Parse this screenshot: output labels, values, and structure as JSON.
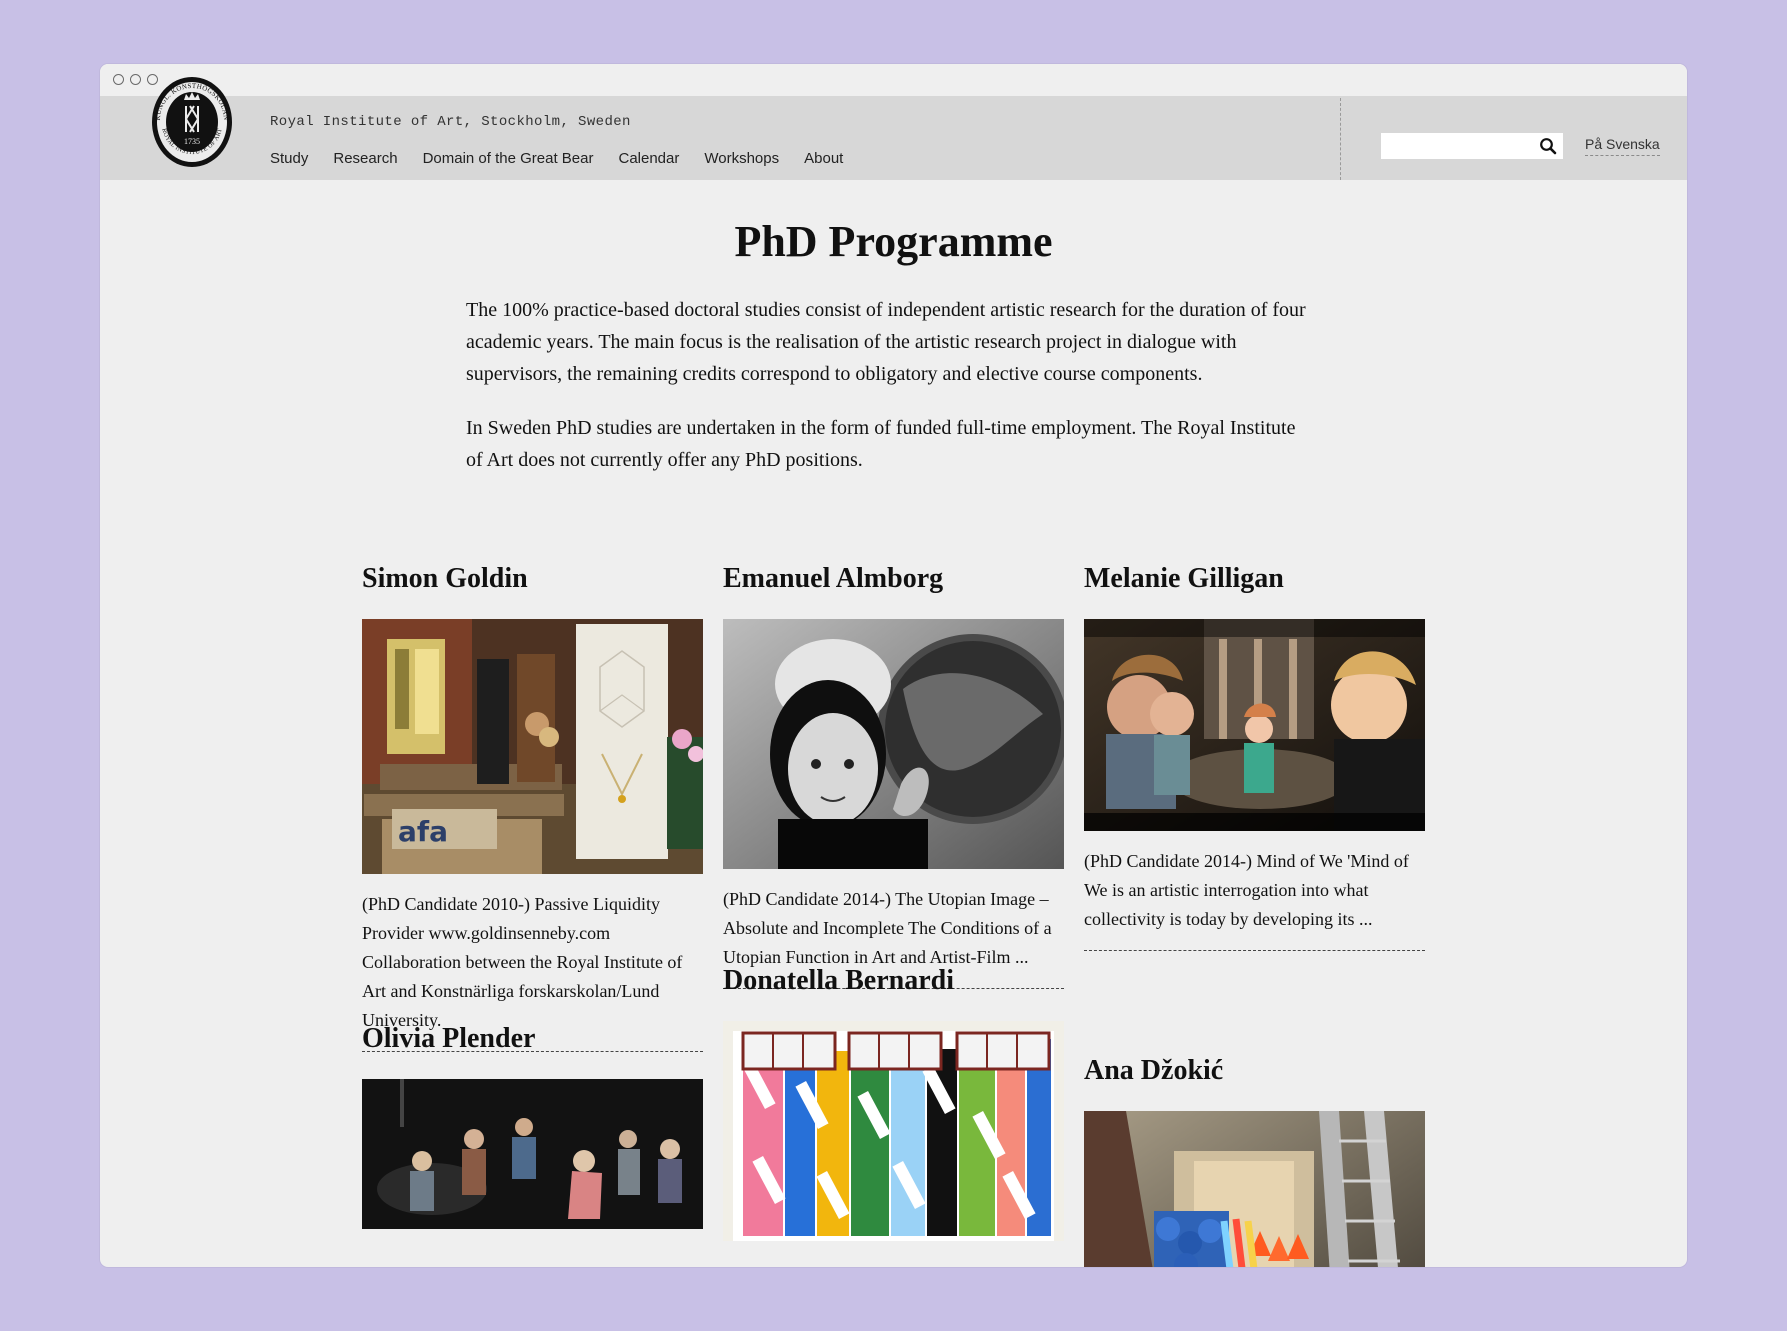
{
  "window": {
    "controls": [
      "close",
      "minimize",
      "maximize"
    ]
  },
  "header": {
    "institute": "Royal Institute of Art, Stockholm, Sweden",
    "logo": {
      "top_text": "KUNGL. KONSTHÖGSKOLAN",
      "bottom_text": "ROYAL INSTITUTE OF ART",
      "year": "1735"
    },
    "nav": [
      {
        "label": "Study"
      },
      {
        "label": "Research"
      },
      {
        "label": "Domain of the Great Bear"
      },
      {
        "label": "Calendar"
      },
      {
        "label": "Workshops"
      },
      {
        "label": "About"
      }
    ],
    "search": {
      "value": "",
      "icon": "search-icon"
    },
    "language_link": "På Svenska"
  },
  "main": {
    "title": "PhD Programme",
    "intro": [
      "The 100% practice-based doctoral studies consist of independent artistic research for the duration of four academic years. The main focus is the realisation of the artistic research project in dialogue with supervisors, the remaining credits correspond to obligatory and elective course components.",
      "In Sweden PhD studies are undertaken in the form of funded full-time employment. The Royal Institute of Art does not currently offer any PhD positions."
    ],
    "candidates": [
      {
        "name": "Simon Goldin",
        "description": "(PhD Candidate 2010-) Passive Liquidity Provider www.goldinsenneby.com Collaboration between the Royal Institute of Art and Konstnärliga forskarskolan/Lund University.",
        "image_text": "afa"
      },
      {
        "name": "Emanuel Almborg",
        "description": "(PhD Candidate 2014-) The Utopian Image – Absolute and Incomplete The Conditions of a Utopian Function in Art and Artist-Film ..."
      },
      {
        "name": "Melanie Gilligan",
        "description": "(PhD Candidate 2014-) Mind of We 'Mind of We is an artistic interrogation into what collectivity is today by developing its ..."
      },
      {
        "name": "Olivia Plender",
        "description": ""
      },
      {
        "name": "Donatella Bernardi",
        "description": ""
      },
      {
        "name": "Ana Džokić",
        "description": ""
      }
    ]
  },
  "colors": {
    "page_bg": "#c8c0e6",
    "window_bg": "#efefef",
    "header_bg": "#d7d7d7",
    "text": "#111111"
  }
}
